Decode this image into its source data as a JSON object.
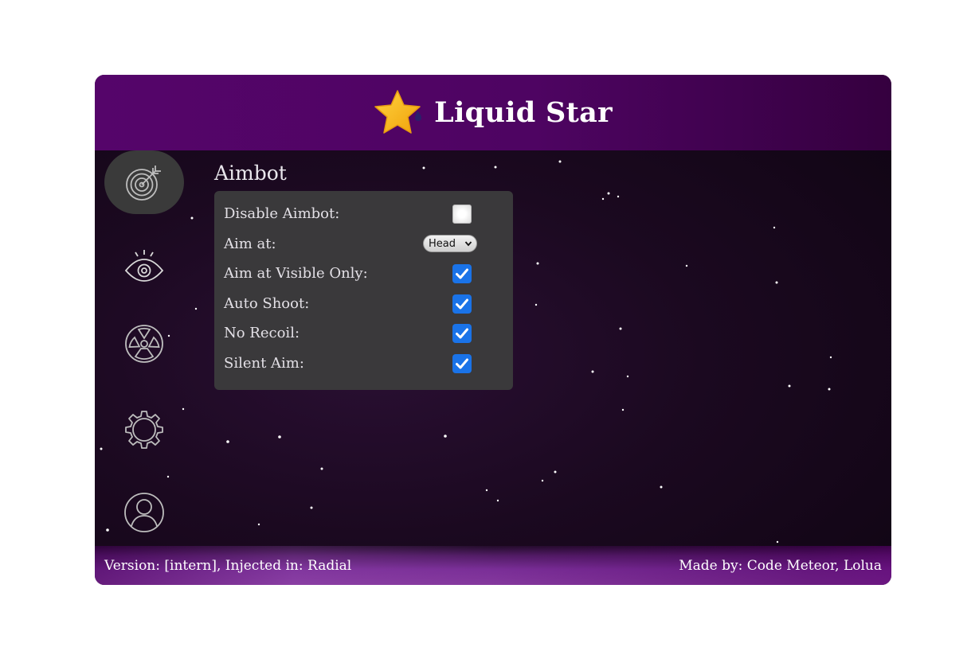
{
  "app": {
    "title": "Liquid Star",
    "logo_icon": "star-drop-icon"
  },
  "sidebar": {
    "items": [
      {
        "name": "aimbot",
        "icon": "target-icon",
        "active": true
      },
      {
        "name": "visuals",
        "icon": "eye-icon",
        "active": false
      },
      {
        "name": "misc",
        "icon": "radiation-icon",
        "active": false
      },
      {
        "name": "settings",
        "icon": "gear-icon",
        "active": false
      },
      {
        "name": "account",
        "icon": "user-icon",
        "active": false
      }
    ]
  },
  "main": {
    "section_title": "Aimbot",
    "options": [
      {
        "label": "Disable Aimbot:",
        "type": "checkbox",
        "checked": false
      },
      {
        "label": "Aim at:",
        "type": "select",
        "value": "Head"
      },
      {
        "label": "Aim at Visible Only:",
        "type": "checkbox",
        "checked": true
      },
      {
        "label": "Auto Shoot:",
        "type": "checkbox",
        "checked": true
      },
      {
        "label": "No Recoil:",
        "type": "checkbox",
        "checked": true
      },
      {
        "label": "Silent Aim:",
        "type": "checkbox",
        "checked": true
      }
    ]
  },
  "footer": {
    "left": "Version: [intern], Injected in: Radial",
    "right": "Made by: Code Meteor, Lolua"
  },
  "colors": {
    "header_bg": "#55056a",
    "panel_bg": "#3a393b",
    "checkbox_accent": "#1a73e8",
    "footer_accent": "#7a2e97"
  }
}
